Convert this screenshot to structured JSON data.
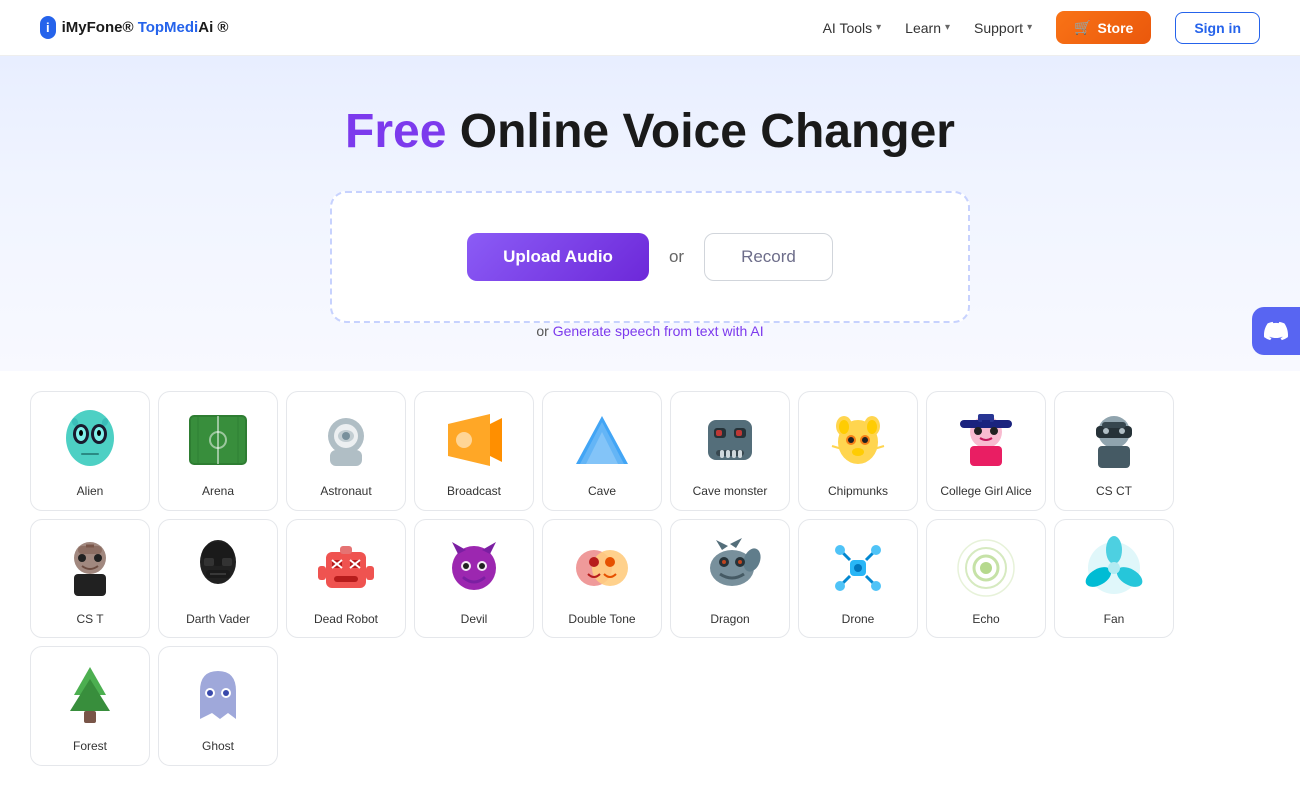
{
  "nav": {
    "logo_icon": "iMyFone",
    "logo_text": "TopMedi",
    "logo_suffix": "Ai",
    "ai_tools_label": "AI Tools",
    "learn_label": "Learn",
    "support_label": "Support",
    "store_label": "Store",
    "store_icon": "🛒",
    "signin_label": "Sign in"
  },
  "hero": {
    "title_free": "Free",
    "title_rest": " Online Voice Changer",
    "upload_btn": "Upload Audio",
    "or_text": "or",
    "record_btn": "Record",
    "generate_prefix": "or ",
    "generate_link": "Generate speech from text with AI"
  },
  "voices": [
    {
      "id": "alien",
      "label": "Alien",
      "color": "#4dd0c4",
      "emoji": "👽"
    },
    {
      "id": "arena",
      "label": "Arena",
      "color": "#4caf50",
      "emoji": "🏟️"
    },
    {
      "id": "astronaut",
      "label": "Astronaut",
      "color": "#90a4ae",
      "emoji": "🧑‍🚀"
    },
    {
      "id": "broadcast",
      "label": "Broadcast",
      "color": "#ffa726",
      "emoji": "📣"
    },
    {
      "id": "cave",
      "label": "Cave",
      "color": "#42a5f5",
      "emoji": "🏔️"
    },
    {
      "id": "cave-monster",
      "label": "Cave monster",
      "color": "#546e7a",
      "emoji": "👾"
    },
    {
      "id": "chipmunks",
      "label": "Chipmunks",
      "color": "#ffd54f",
      "emoji": "🐿️"
    },
    {
      "id": "college-girl",
      "label": "College Girl Alice",
      "color": "#ef9a9a",
      "emoji": "👩‍🎓"
    },
    {
      "id": "csct",
      "label": "CS CT",
      "color": "#455a64",
      "emoji": "🥷"
    },
    {
      "id": "cst",
      "label": "CS T",
      "color": "#37474f",
      "emoji": "🧔"
    },
    {
      "id": "darth-vader",
      "label": "Darth Vader",
      "color": "#212121",
      "emoji": "🦹"
    },
    {
      "id": "dead-robot",
      "label": "Dead Robot",
      "color": "#ef5350",
      "emoji": "🤖"
    },
    {
      "id": "devil",
      "label": "Devil",
      "color": "#9c27b0",
      "emoji": "😈"
    },
    {
      "id": "double-tone",
      "label": "Double Tone",
      "color": "#e57373",
      "emoji": "🎭"
    },
    {
      "id": "dragon",
      "label": "Dragon",
      "color": "#78909c",
      "emoji": "🐲"
    },
    {
      "id": "drone",
      "label": "Drone",
      "color": "#4fc3f7",
      "emoji": "🚁"
    },
    {
      "id": "echo",
      "label": "Echo",
      "color": "#aed581",
      "emoji": "〰️"
    },
    {
      "id": "fan",
      "label": "Fan",
      "color": "#4dd0e1",
      "emoji": "💨"
    },
    {
      "id": "forest",
      "label": "Forest",
      "color": "#66bb6a",
      "emoji": "🌲"
    },
    {
      "id": "ghost",
      "label": "Ghost",
      "color": "#9fa8da",
      "emoji": "👻"
    }
  ]
}
